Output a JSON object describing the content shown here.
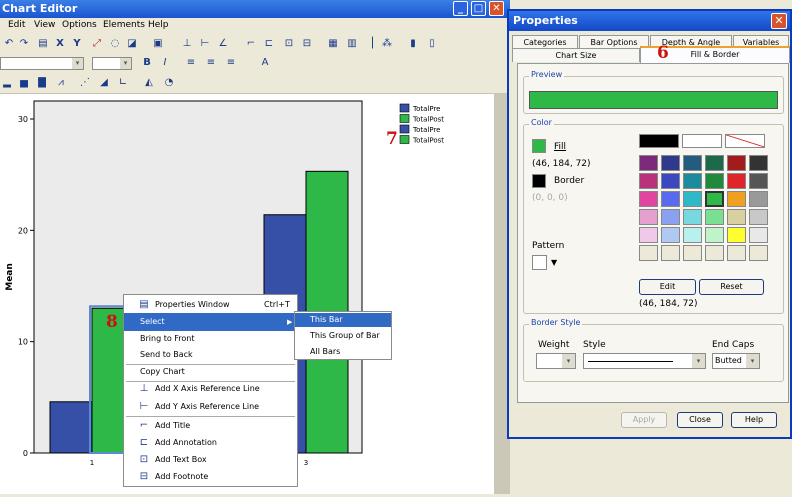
{
  "chart_editor": {
    "title": "Chart Editor",
    "menu": [
      "Edit",
      "View",
      "Options",
      "Elements",
      "Help"
    ],
    "toolbar_icons": [
      "undo-icon",
      "redo-icon",
      "properties-icon",
      "x-axis-icon",
      "y-axis-icon",
      "zoom-icon",
      "lasso-icon",
      "chart-icon"
    ]
  },
  "chart_data": {
    "type": "bar",
    "categories": [
      "1",
      "3"
    ],
    "series": [
      {
        "name": "TotalPre",
        "values": [
          4.6,
          21.4
        ],
        "color": "#3650a8"
      },
      {
        "name": "TotalPost",
        "values": [
          13.0,
          25.3
        ],
        "color": "#2eb848"
      }
    ],
    "legend_entries": [
      "TotalPre",
      "TotalPost",
      "TotalPre",
      "TotalPost"
    ],
    "ylabel": "Mean",
    "yticks": [
      "0",
      "10",
      "20",
      "30"
    ],
    "ylim": [
      0,
      30
    ],
    "legend_position": "top-right"
  },
  "context_menu": {
    "items": [
      {
        "label": "Properties Window",
        "shortcut": "Ctrl+T",
        "icon": "properties-window-icon"
      },
      {
        "label": "Select",
        "icon": "",
        "submenu": true
      },
      {
        "label": "Bring to Front",
        "icon": ""
      },
      {
        "label": "Send to Back",
        "icon": ""
      },
      {
        "label": "Copy Chart",
        "icon": ""
      },
      {
        "label": "Add X Axis Reference Line",
        "icon": "x-reference-line-icon"
      },
      {
        "label": "Add Y Axis Reference Line",
        "icon": "y-reference-line-icon"
      },
      {
        "label": "Add Title",
        "icon": "title-icon"
      },
      {
        "label": "Add Annotation",
        "icon": "annotation-icon"
      },
      {
        "label": "Add Text Box",
        "icon": "text-box-icon"
      },
      {
        "label": "Add Footnote",
        "icon": "footnote-icon"
      }
    ],
    "submenu": [
      "This Bar",
      "This Group of Bar",
      "All Bars"
    ]
  },
  "annotations": {
    "six": "6",
    "seven": "7",
    "eight": "8"
  },
  "properties": {
    "title": "Properties",
    "tabs_row1": [
      "Categories",
      "Bar Options",
      "Depth & Angle",
      "Variables"
    ],
    "tabs_row2": [
      "Chart Size",
      "Fill & Border"
    ],
    "preview_label": "Preview",
    "preview_color": "#2eb848",
    "color_label": "Color",
    "fill_label": "Fill",
    "fill_rgb": "(46, 184, 72)",
    "border_label": "Border",
    "border_rgb": "(0, 0, 0)",
    "pattern_label": "Pattern",
    "edit_label": "Edit",
    "reset_label": "Reset",
    "selected_rgb": "(46, 184, 72)",
    "palette": [
      [
        "#000000",
        "#ffffff",
        "#ffffff"
      ],
      [
        "#7c2b7c",
        "#303a8c",
        "#245c80",
        "#1d6a4a",
        "#a31c1c",
        "#333333"
      ],
      [
        "#b8327c",
        "#3c48c0",
        "#1c8c9c",
        "#1f8a3c",
        "#e0242c",
        "#555555"
      ],
      [
        "#e046a0",
        "#5a6af0",
        "#2eb8c8",
        "#2eb848",
        "#f0a020",
        "#999999"
      ],
      [
        "#e6a0d0",
        "#8ca0f0",
        "#78d8e0",
        "#78e090",
        "#d8d0a0",
        "#c8c8c8"
      ],
      [
        "#f0c8e8",
        "#b0c8f4",
        "#b8f0f0",
        "#c0f4c8",
        "#ffff30",
        "#e8e8e8"
      ],
      [
        "#ece9d8",
        "#ece9d8",
        "#ece9d8",
        "#ece9d8",
        "#ece9d8",
        "#ece9d8"
      ]
    ],
    "border_style_label": "Border Style",
    "weight_label": "Weight",
    "style_label": "Style",
    "end_caps_label": "End Caps",
    "end_caps_value": "Butted",
    "apply_label": "Apply",
    "close_label": "Close",
    "help_label": "Help"
  }
}
